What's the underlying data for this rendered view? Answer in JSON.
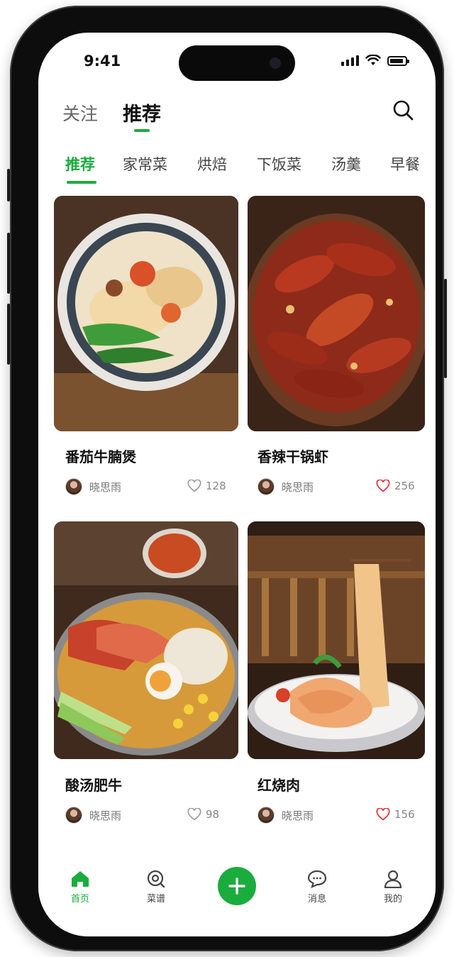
{
  "status_bar": {
    "time": "9:41"
  },
  "header": {
    "tabs": [
      {
        "label": "关注",
        "active": false
      },
      {
        "label": "推荐",
        "active": true
      }
    ],
    "search_icon": "search-icon"
  },
  "categories": [
    {
      "label": "推荐",
      "active": true
    },
    {
      "label": "家常菜",
      "active": false
    },
    {
      "label": "烘焙",
      "active": false
    },
    {
      "label": "下饭菜",
      "active": false
    },
    {
      "label": "汤羹",
      "active": false
    },
    {
      "label": "早餐",
      "active": false
    }
  ],
  "cards": [
    {
      "title": "番茄牛腩煲",
      "author": "晓思雨",
      "likes": "128",
      "liked": false
    },
    {
      "title": "香辣干锅虾",
      "author": "晓思雨",
      "likes": "256",
      "liked": true
    },
    {
      "title": "酸汤肥牛",
      "author": "晓思雨",
      "likes": "98",
      "liked": false
    },
    {
      "title": "红烧肉",
      "author": "晓思雨",
      "likes": "156",
      "liked": true
    }
  ],
  "tabbar": {
    "items": [
      {
        "label": "首页",
        "icon": "home-icon",
        "active": true
      },
      {
        "label": "菜谱",
        "icon": "recipe-search-icon",
        "active": false
      },
      {
        "label": "消息",
        "icon": "chat-bubble-icon",
        "active": false
      },
      {
        "label": "我的",
        "icon": "user-icon",
        "active": false
      }
    ],
    "add_icon": "plus-icon"
  },
  "colors": {
    "accent": "#1aad3d",
    "liked": "#e0393e",
    "text": "#111111"
  }
}
